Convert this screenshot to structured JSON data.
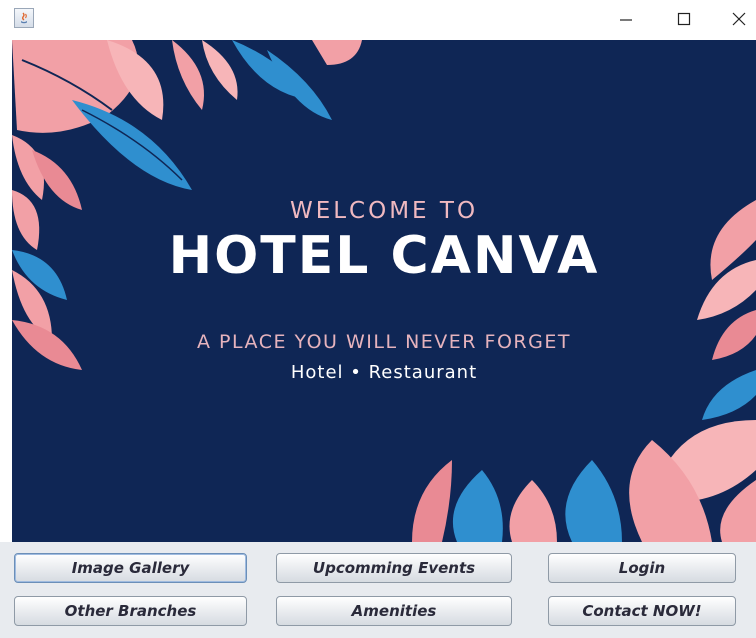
{
  "window": {
    "title": "",
    "controls": {
      "minimize_icon": "minimize-icon",
      "maximize_icon": "maximize-icon",
      "close_icon": "close-icon"
    }
  },
  "banner": {
    "welcome": "WELCOME TO",
    "name": "HOTEL CANVA",
    "tagline": "A PLACE YOU WILL NEVER FORGET",
    "services": "Hotel  •  Restaurant",
    "colors": {
      "background": "#0f2655",
      "pink": "#f2a0a6",
      "blue": "#2f8fcf",
      "welcome_text": "#f0b9c0"
    }
  },
  "buttons": {
    "image_gallery": "Image Gallery",
    "upcoming_events": "Upcomming Events",
    "login": "Login",
    "other_branches": "Other Branches",
    "amenities": "Amenities",
    "contact_now": "Contact NOW!"
  }
}
